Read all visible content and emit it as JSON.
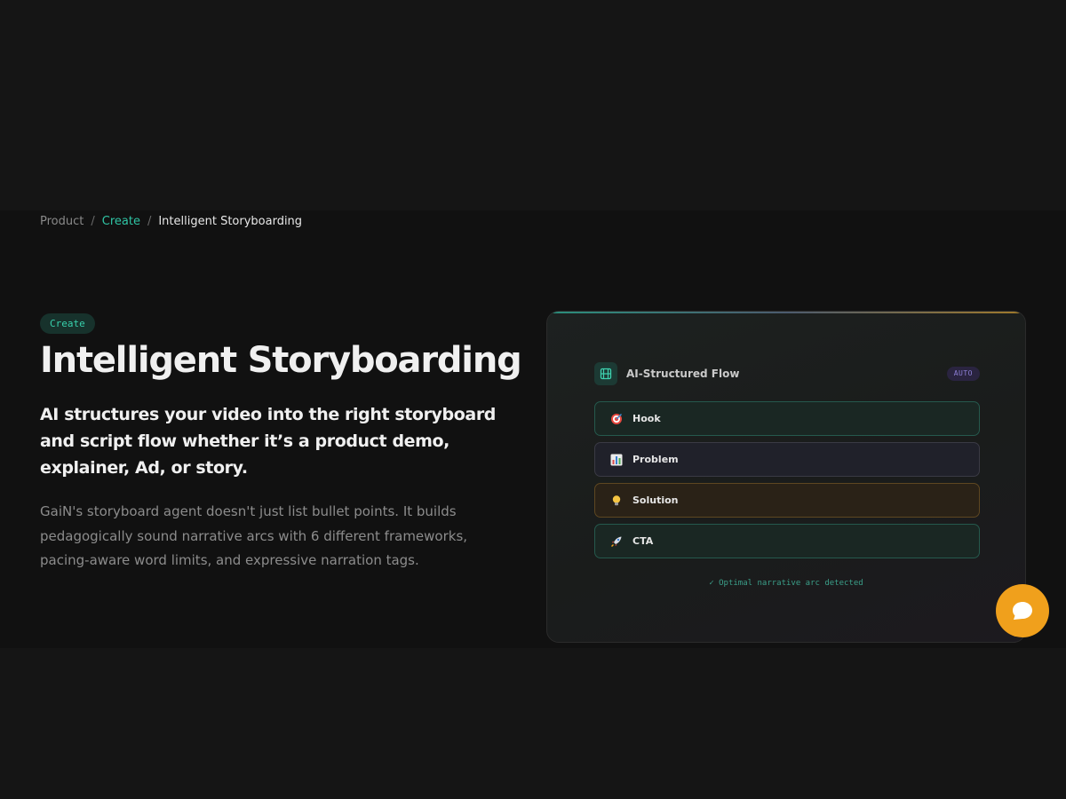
{
  "breadcrumb": {
    "items": [
      "Product",
      "Create",
      "Intelligent Storyboarding"
    ],
    "separator": "/"
  },
  "hero": {
    "pill": "Create",
    "title": "Intelligent Storyboarding",
    "subtitle": "AI structures your video into the right storyboard and script flow whether it’s a product demo, explainer, Ad, or story.",
    "description": "GaiN's storyboard agent doesn't just list bullet points. It builds pedagogically sound narrative arcs with 6 different frameworks, pacing-aware word limits, and expressive narration tags."
  },
  "card": {
    "header_icon": "film-icon",
    "title": "AI-Structured Flow",
    "badge": "AUTO",
    "steps": [
      {
        "label": "Hook",
        "icon": "target-icon",
        "style": "teal"
      },
      {
        "label": "Problem",
        "icon": "bar-chart-icon",
        "style": "gray"
      },
      {
        "label": "Solution",
        "icon": "lightbulb-icon",
        "style": "orange"
      },
      {
        "label": "CTA",
        "icon": "rocket-icon",
        "style": "teal"
      }
    ],
    "status": "✓ Optimal narrative arc detected"
  },
  "chat": {
    "icon": "chat-bubble-icon"
  },
  "colors": {
    "accent": "#2fc4a4",
    "chat": "#f0a01c",
    "background": "#151515"
  }
}
